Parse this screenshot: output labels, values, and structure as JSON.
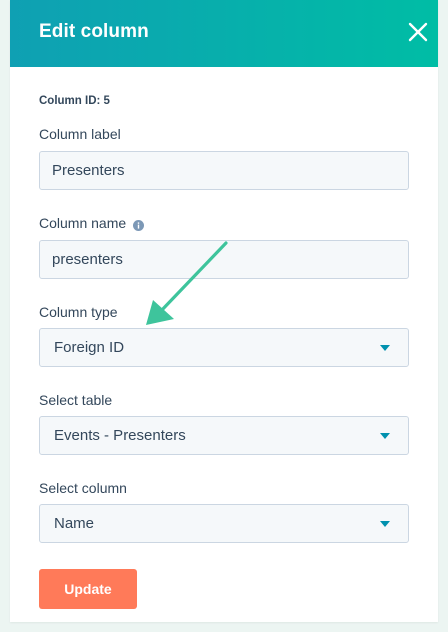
{
  "header": {
    "title": "Edit column",
    "close_icon": "close-icon"
  },
  "form": {
    "column_id_label": "Column ID: 5",
    "column_label": {
      "label": "Column label",
      "value": "Presenters"
    },
    "column_name": {
      "label": "Column name",
      "value": "presenters",
      "info_icon": "info-icon"
    },
    "column_type": {
      "label": "Column type",
      "value": "Foreign ID"
    },
    "select_table": {
      "label": "Select table",
      "value": "Events - Presenters"
    },
    "select_column": {
      "label": "Select column",
      "value": "Name"
    },
    "update_label": "Update"
  },
  "colors": {
    "header_start": "#0fa0b3",
    "header_end": "#00bda5",
    "primary_button": "#ff7a59",
    "caret": "#0091ae",
    "annotation_arrow": "#3ec49c",
    "text": "#33475b"
  }
}
